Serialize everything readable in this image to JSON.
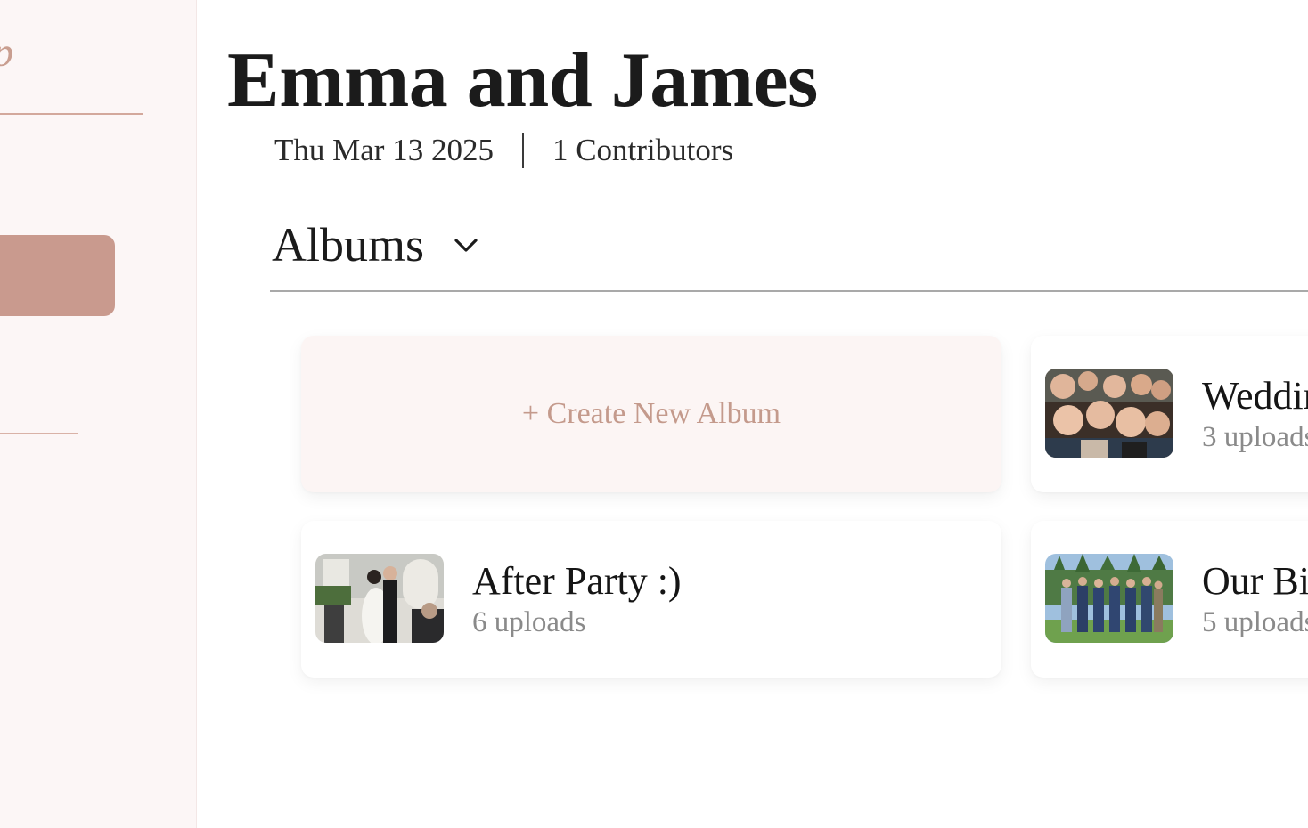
{
  "sidebar": {
    "brand_fragment": "p"
  },
  "event": {
    "title": "Emma and James",
    "date": "Thu Mar 13 2025",
    "contributors": "1 Contributors"
  },
  "albums_section": {
    "label": "Albums",
    "create_label": "+ Create New Album",
    "items": [
      {
        "title": "Weddin",
        "count": "3 uploads",
        "thumb": "group-selfie-photo"
      },
      {
        "title": "After Party :)",
        "count": "6 uploads",
        "thumb": "first-dance-photo"
      },
      {
        "title": "Our Bi",
        "count": "5 uploads",
        "thumb": "groomsmen-photo"
      }
    ]
  },
  "colors": {
    "accent": "#c99a8e",
    "sidebar_bg": "#fcf6f6",
    "create_bg": "#fcf5f4"
  }
}
